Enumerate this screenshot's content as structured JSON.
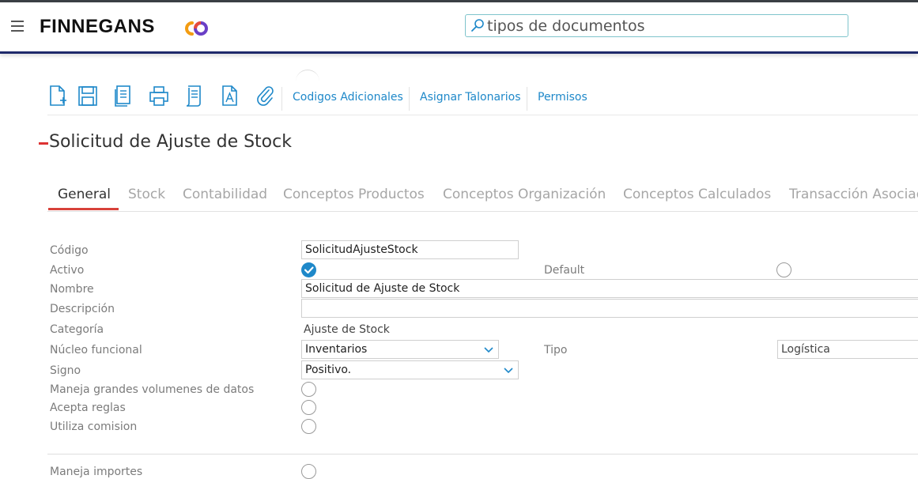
{
  "header": {
    "brand": "FINNEGANS",
    "search_value": "tipos de documentos",
    "colors": {
      "nav_bar": "#1f2a6b",
      "logo_orange": "#f39c12",
      "logo_purple": "#6a3fc6"
    }
  },
  "toolbar": {
    "icons": [
      "new-document-icon",
      "save-icon",
      "copy-icon",
      "print-icon",
      "list-report-icon",
      "text-document-icon",
      "attachment-icon"
    ],
    "links": [
      "Codigos Adicionales",
      "Asignar Talonarios",
      "Permisos"
    ]
  },
  "page": {
    "title": "Solicitud de Ajuste de Stock"
  },
  "tabs": [
    "General",
    "Stock",
    "Contabilidad",
    "Conceptos Productos",
    "Conceptos Organización",
    "Conceptos Calculados",
    "Transacción Asociada"
  ],
  "form": {
    "codigo": {
      "label": "Código",
      "value": "SolicitudAjusteStock"
    },
    "activo": {
      "label": "Activo",
      "checked": true
    },
    "default": {
      "label": "Default",
      "checked": false
    },
    "nombre": {
      "label": "Nombre",
      "value": "Solicitud de Ajuste de Stock"
    },
    "descripcion": {
      "label": "Descripción",
      "value": ""
    },
    "categoria": {
      "label": "Categoría",
      "value": "Ajuste de Stock"
    },
    "nucleo": {
      "label": "Núcleo funcional",
      "value": "Inventarios"
    },
    "tipo": {
      "label": "Tipo",
      "value": "Logística"
    },
    "signo": {
      "label": "Signo",
      "value": "Positivo."
    },
    "grandes": {
      "label": "Maneja grandes volumenes de datos",
      "checked": false
    },
    "reglas": {
      "label": "Acepta reglas",
      "checked": false
    },
    "comision": {
      "label": "Utiliza comision",
      "checked": false
    },
    "importes": {
      "label": "Maneja importes",
      "checked": false
    }
  },
  "colors": {
    "accent": "#1e88c9",
    "tab_active_underline": "#d8413a",
    "title_accent": "#dd3333"
  }
}
